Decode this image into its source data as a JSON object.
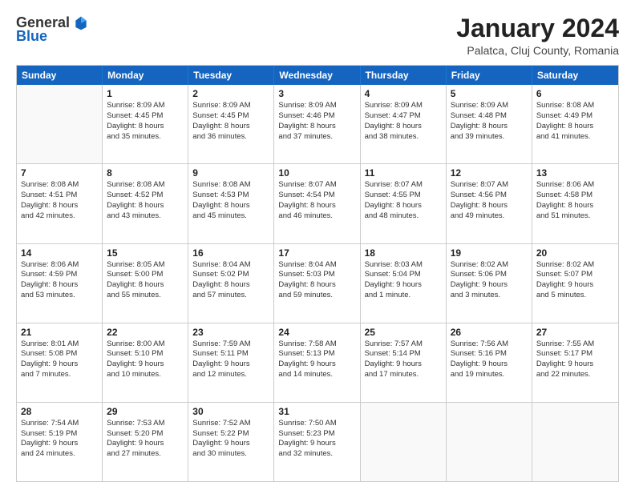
{
  "logo": {
    "general": "General",
    "blue": "Blue"
  },
  "title": "January 2024",
  "subtitle": "Palatca, Cluj County, Romania",
  "header_days": [
    "Sunday",
    "Monday",
    "Tuesday",
    "Wednesday",
    "Thursday",
    "Friday",
    "Saturday"
  ],
  "weeks": [
    [
      {
        "day": "",
        "lines": []
      },
      {
        "day": "1",
        "lines": [
          "Sunrise: 8:09 AM",
          "Sunset: 4:45 PM",
          "Daylight: 8 hours",
          "and 35 minutes."
        ]
      },
      {
        "day": "2",
        "lines": [
          "Sunrise: 8:09 AM",
          "Sunset: 4:45 PM",
          "Daylight: 8 hours",
          "and 36 minutes."
        ]
      },
      {
        "day": "3",
        "lines": [
          "Sunrise: 8:09 AM",
          "Sunset: 4:46 PM",
          "Daylight: 8 hours",
          "and 37 minutes."
        ]
      },
      {
        "day": "4",
        "lines": [
          "Sunrise: 8:09 AM",
          "Sunset: 4:47 PM",
          "Daylight: 8 hours",
          "and 38 minutes."
        ]
      },
      {
        "day": "5",
        "lines": [
          "Sunrise: 8:09 AM",
          "Sunset: 4:48 PM",
          "Daylight: 8 hours",
          "and 39 minutes."
        ]
      },
      {
        "day": "6",
        "lines": [
          "Sunrise: 8:08 AM",
          "Sunset: 4:49 PM",
          "Daylight: 8 hours",
          "and 41 minutes."
        ]
      }
    ],
    [
      {
        "day": "7",
        "lines": [
          "Sunrise: 8:08 AM",
          "Sunset: 4:51 PM",
          "Daylight: 8 hours",
          "and 42 minutes."
        ]
      },
      {
        "day": "8",
        "lines": [
          "Sunrise: 8:08 AM",
          "Sunset: 4:52 PM",
          "Daylight: 8 hours",
          "and 43 minutes."
        ]
      },
      {
        "day": "9",
        "lines": [
          "Sunrise: 8:08 AM",
          "Sunset: 4:53 PM",
          "Daylight: 8 hours",
          "and 45 minutes."
        ]
      },
      {
        "day": "10",
        "lines": [
          "Sunrise: 8:07 AM",
          "Sunset: 4:54 PM",
          "Daylight: 8 hours",
          "and 46 minutes."
        ]
      },
      {
        "day": "11",
        "lines": [
          "Sunrise: 8:07 AM",
          "Sunset: 4:55 PM",
          "Daylight: 8 hours",
          "and 48 minutes."
        ]
      },
      {
        "day": "12",
        "lines": [
          "Sunrise: 8:07 AM",
          "Sunset: 4:56 PM",
          "Daylight: 8 hours",
          "and 49 minutes."
        ]
      },
      {
        "day": "13",
        "lines": [
          "Sunrise: 8:06 AM",
          "Sunset: 4:58 PM",
          "Daylight: 8 hours",
          "and 51 minutes."
        ]
      }
    ],
    [
      {
        "day": "14",
        "lines": [
          "Sunrise: 8:06 AM",
          "Sunset: 4:59 PM",
          "Daylight: 8 hours",
          "and 53 minutes."
        ]
      },
      {
        "day": "15",
        "lines": [
          "Sunrise: 8:05 AM",
          "Sunset: 5:00 PM",
          "Daylight: 8 hours",
          "and 55 minutes."
        ]
      },
      {
        "day": "16",
        "lines": [
          "Sunrise: 8:04 AM",
          "Sunset: 5:02 PM",
          "Daylight: 8 hours",
          "and 57 minutes."
        ]
      },
      {
        "day": "17",
        "lines": [
          "Sunrise: 8:04 AM",
          "Sunset: 5:03 PM",
          "Daylight: 8 hours",
          "and 59 minutes."
        ]
      },
      {
        "day": "18",
        "lines": [
          "Sunrise: 8:03 AM",
          "Sunset: 5:04 PM",
          "Daylight: 9 hours",
          "and 1 minute."
        ]
      },
      {
        "day": "19",
        "lines": [
          "Sunrise: 8:02 AM",
          "Sunset: 5:06 PM",
          "Daylight: 9 hours",
          "and 3 minutes."
        ]
      },
      {
        "day": "20",
        "lines": [
          "Sunrise: 8:02 AM",
          "Sunset: 5:07 PM",
          "Daylight: 9 hours",
          "and 5 minutes."
        ]
      }
    ],
    [
      {
        "day": "21",
        "lines": [
          "Sunrise: 8:01 AM",
          "Sunset: 5:08 PM",
          "Daylight: 9 hours",
          "and 7 minutes."
        ]
      },
      {
        "day": "22",
        "lines": [
          "Sunrise: 8:00 AM",
          "Sunset: 5:10 PM",
          "Daylight: 9 hours",
          "and 10 minutes."
        ]
      },
      {
        "day": "23",
        "lines": [
          "Sunrise: 7:59 AM",
          "Sunset: 5:11 PM",
          "Daylight: 9 hours",
          "and 12 minutes."
        ]
      },
      {
        "day": "24",
        "lines": [
          "Sunrise: 7:58 AM",
          "Sunset: 5:13 PM",
          "Daylight: 9 hours",
          "and 14 minutes."
        ]
      },
      {
        "day": "25",
        "lines": [
          "Sunrise: 7:57 AM",
          "Sunset: 5:14 PM",
          "Daylight: 9 hours",
          "and 17 minutes."
        ]
      },
      {
        "day": "26",
        "lines": [
          "Sunrise: 7:56 AM",
          "Sunset: 5:16 PM",
          "Daylight: 9 hours",
          "and 19 minutes."
        ]
      },
      {
        "day": "27",
        "lines": [
          "Sunrise: 7:55 AM",
          "Sunset: 5:17 PM",
          "Daylight: 9 hours",
          "and 22 minutes."
        ]
      }
    ],
    [
      {
        "day": "28",
        "lines": [
          "Sunrise: 7:54 AM",
          "Sunset: 5:19 PM",
          "Daylight: 9 hours",
          "and 24 minutes."
        ]
      },
      {
        "day": "29",
        "lines": [
          "Sunrise: 7:53 AM",
          "Sunset: 5:20 PM",
          "Daylight: 9 hours",
          "and 27 minutes."
        ]
      },
      {
        "day": "30",
        "lines": [
          "Sunrise: 7:52 AM",
          "Sunset: 5:22 PM",
          "Daylight: 9 hours",
          "and 30 minutes."
        ]
      },
      {
        "day": "31",
        "lines": [
          "Sunrise: 7:50 AM",
          "Sunset: 5:23 PM",
          "Daylight: 9 hours",
          "and 32 minutes."
        ]
      },
      {
        "day": "",
        "lines": []
      },
      {
        "day": "",
        "lines": []
      },
      {
        "day": "",
        "lines": []
      }
    ]
  ]
}
